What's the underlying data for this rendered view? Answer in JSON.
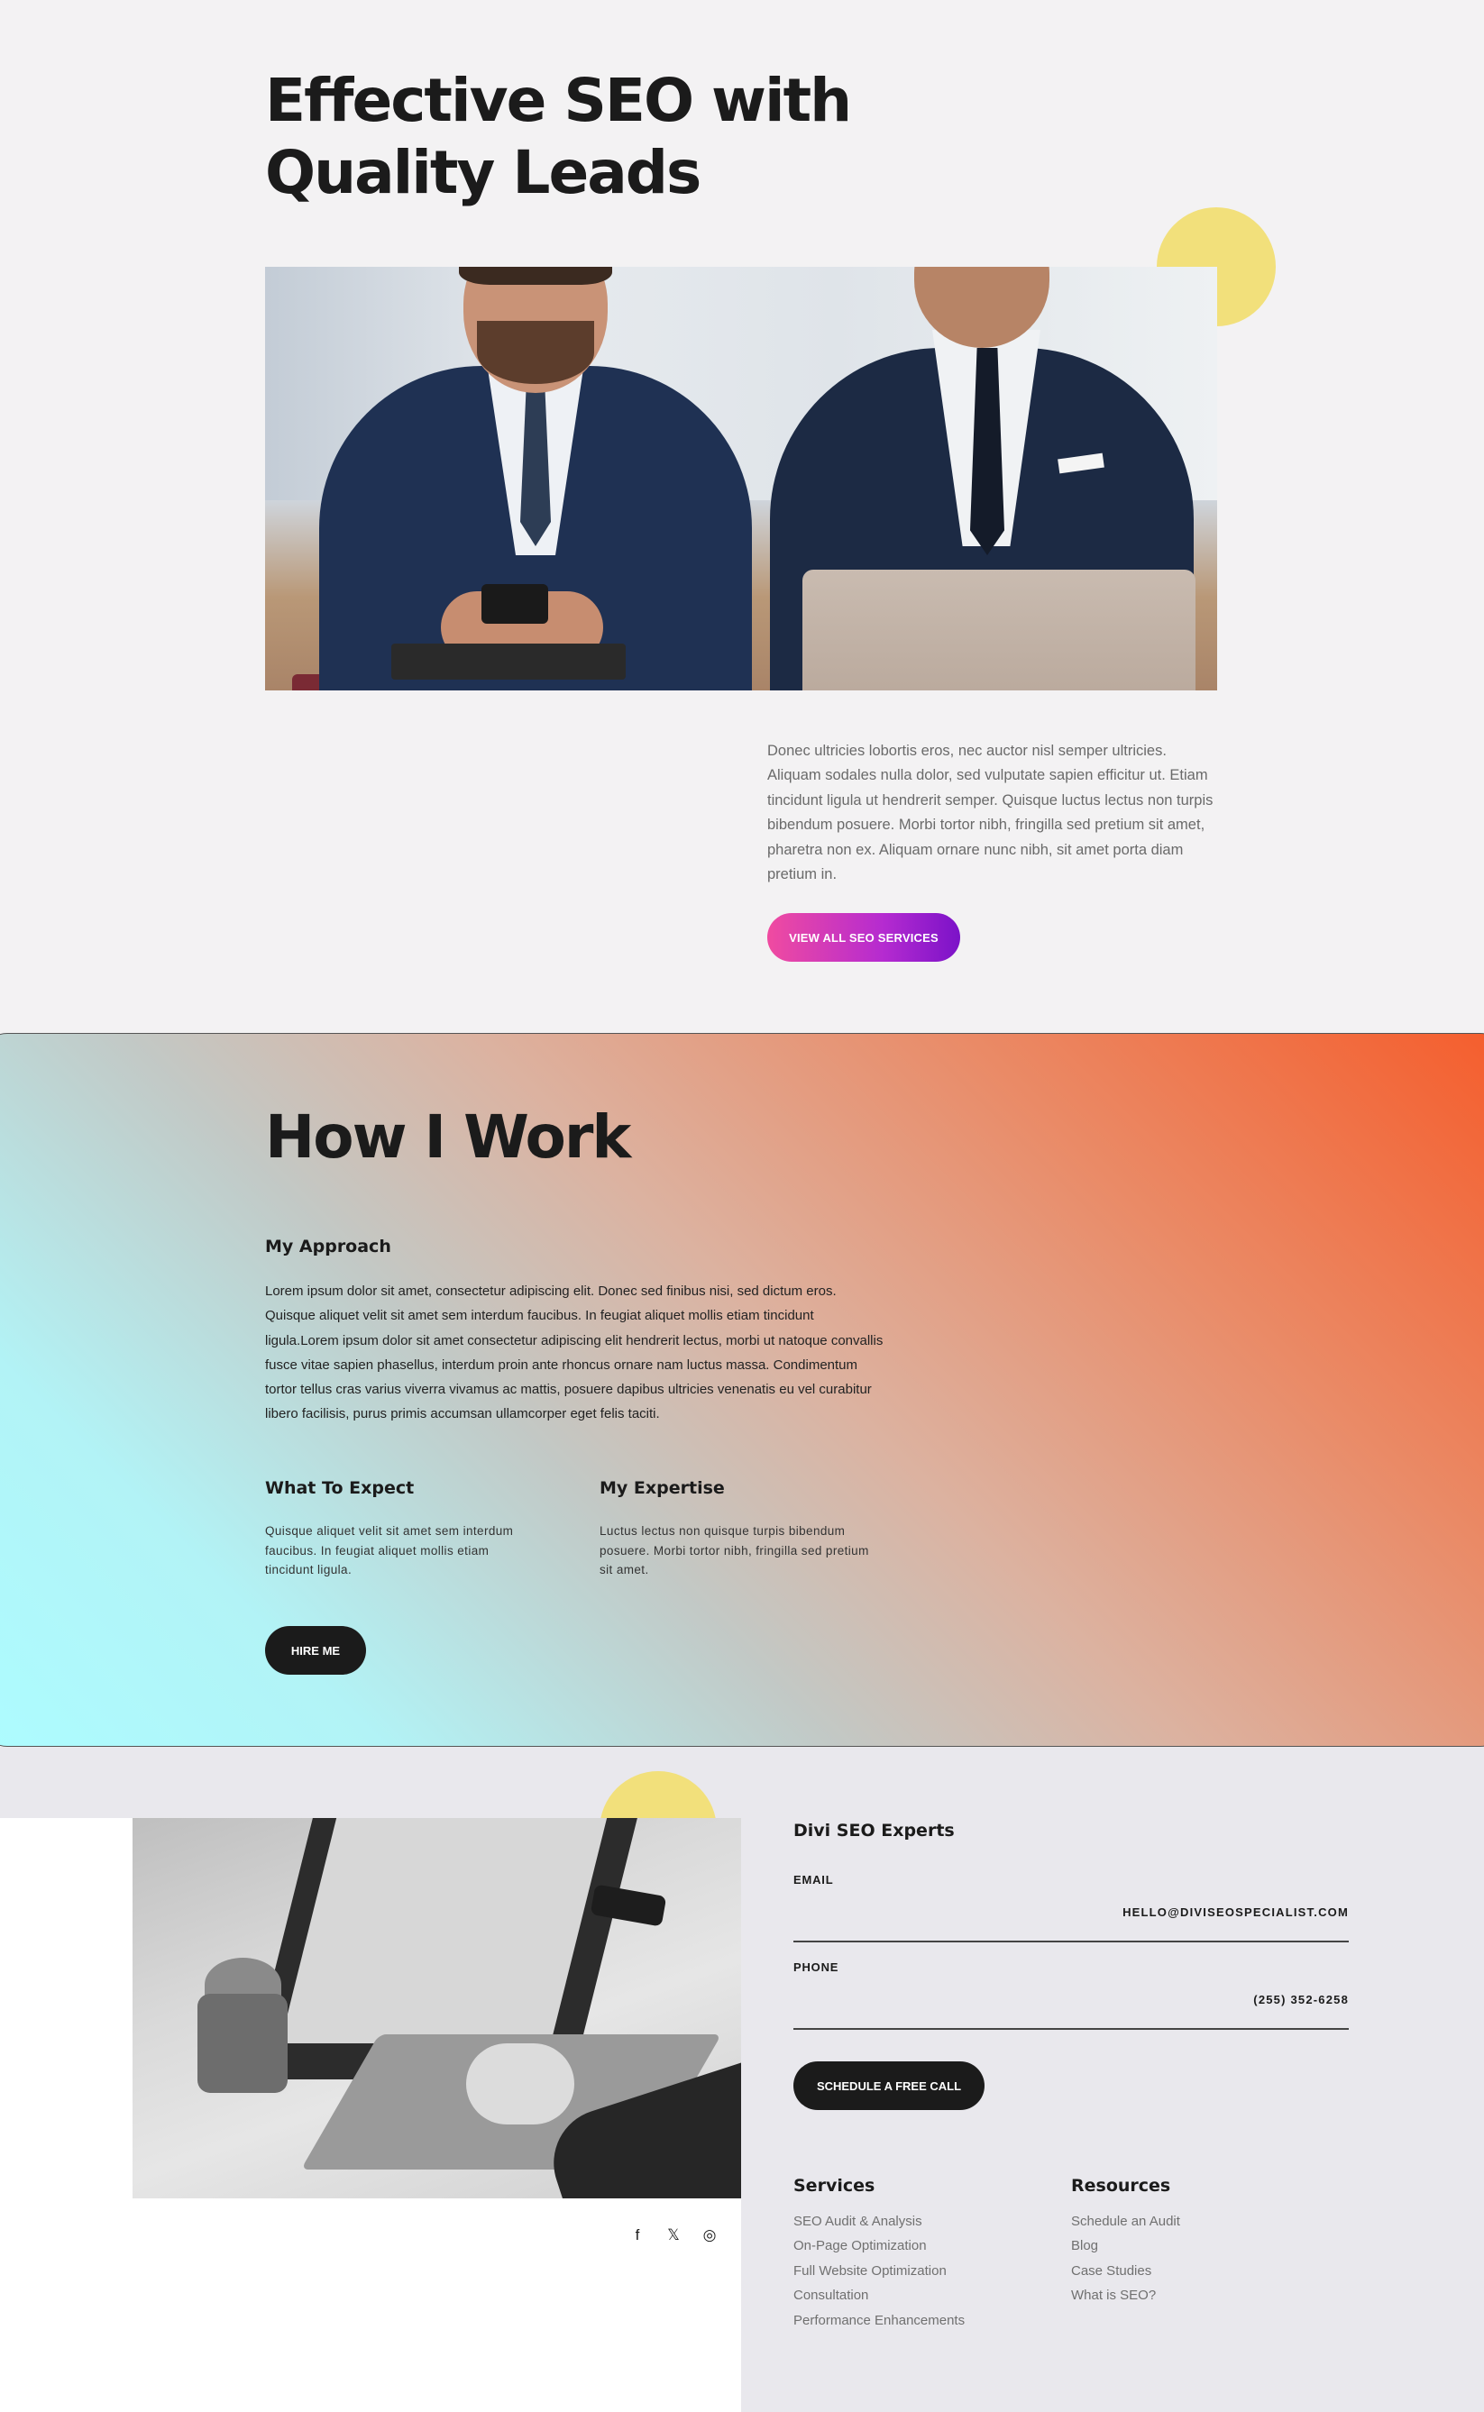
{
  "hero": {
    "title_line1": "Effective SEO with",
    "title_line2": "Quality Leads",
    "paragraph": "Donec ultricies lobortis eros, nec auctor nisl semper ultricies. Aliquam sodales nulla dolor, sed vulputate sapien efficitur ut. Etiam tincidunt ligula ut hendrerit semper. Quisque luctus lectus non turpis bibendum posuere. Morbi tortor nibh, fringilla sed pretium sit amet, pharetra non ex. Aliquam ornare nunc nibh, sit amet porta diam pretium in.",
    "button_label": "View All SEO Services"
  },
  "work": {
    "title": "How I Work",
    "approach_heading": "My Approach",
    "approach_text": "Lorem ipsum dolor sit amet, consectetur adipiscing elit. Donec sed finibus nisi, sed dictum eros. Quisque aliquet velit sit amet sem interdum faucibus. In feugiat aliquet mollis etiam tincidunt ligula.Lorem ipsum dolor sit amet consectetur adipiscing elit hendrerit lectus, morbi ut natoque convallis fusce vitae sapien phasellus, interdum proin ante rhoncus ornare nam luctus massa. Condimentum tortor tellus cras varius viverra vivamus ac mattis, posuere dapibus ultricies venenatis eu vel curabitur libero facilisis, purus primis accumsan ullamcorper eget felis taciti.",
    "expect_heading": "What To Expect",
    "expect_text": "Quisque aliquet velit sit amet sem interdum faucibus. In feugiat aliquet mollis etiam tincidunt ligula.",
    "expertise_heading": "My Expertise",
    "expertise_text": "Luctus lectus non quisque turpis bibendum posuere. Morbi tortor nibh, fringilla sed pretium sit amet.",
    "button_label": "Hire Me"
  },
  "footer": {
    "contact_title": "Divi SEO Experts",
    "email_label": "EMAIL",
    "email_value": "HELLO@DIVISEOSPECIALIST.COM",
    "phone_label": "PHONE",
    "phone_value": "(255) 352-6258",
    "schedule_button": "Schedule a Free Call",
    "social": {
      "facebook": "f",
      "x": "𝕏",
      "instagram": "◎"
    },
    "services_heading": "Services",
    "services": [
      "SEO Audit & Analysis",
      "On-Page Optimization",
      "Full Website Optimization",
      "Consultation",
      "Performance Enhancements"
    ],
    "resources_heading": "Resources",
    "resources": [
      "Schedule an Audit",
      "Blog",
      "Case Studies",
      "What is SEO?"
    ]
  },
  "colors": {
    "background": "#f3f2f3",
    "accent_yellow": "#f2e07b",
    "button_gradient_start": "#f04ba0",
    "button_gradient_end": "#7b12c8",
    "dark_button": "#1b1b1b",
    "section_gradient_warm": "#f55d2c",
    "section_gradient_cool": "#adfcff"
  }
}
